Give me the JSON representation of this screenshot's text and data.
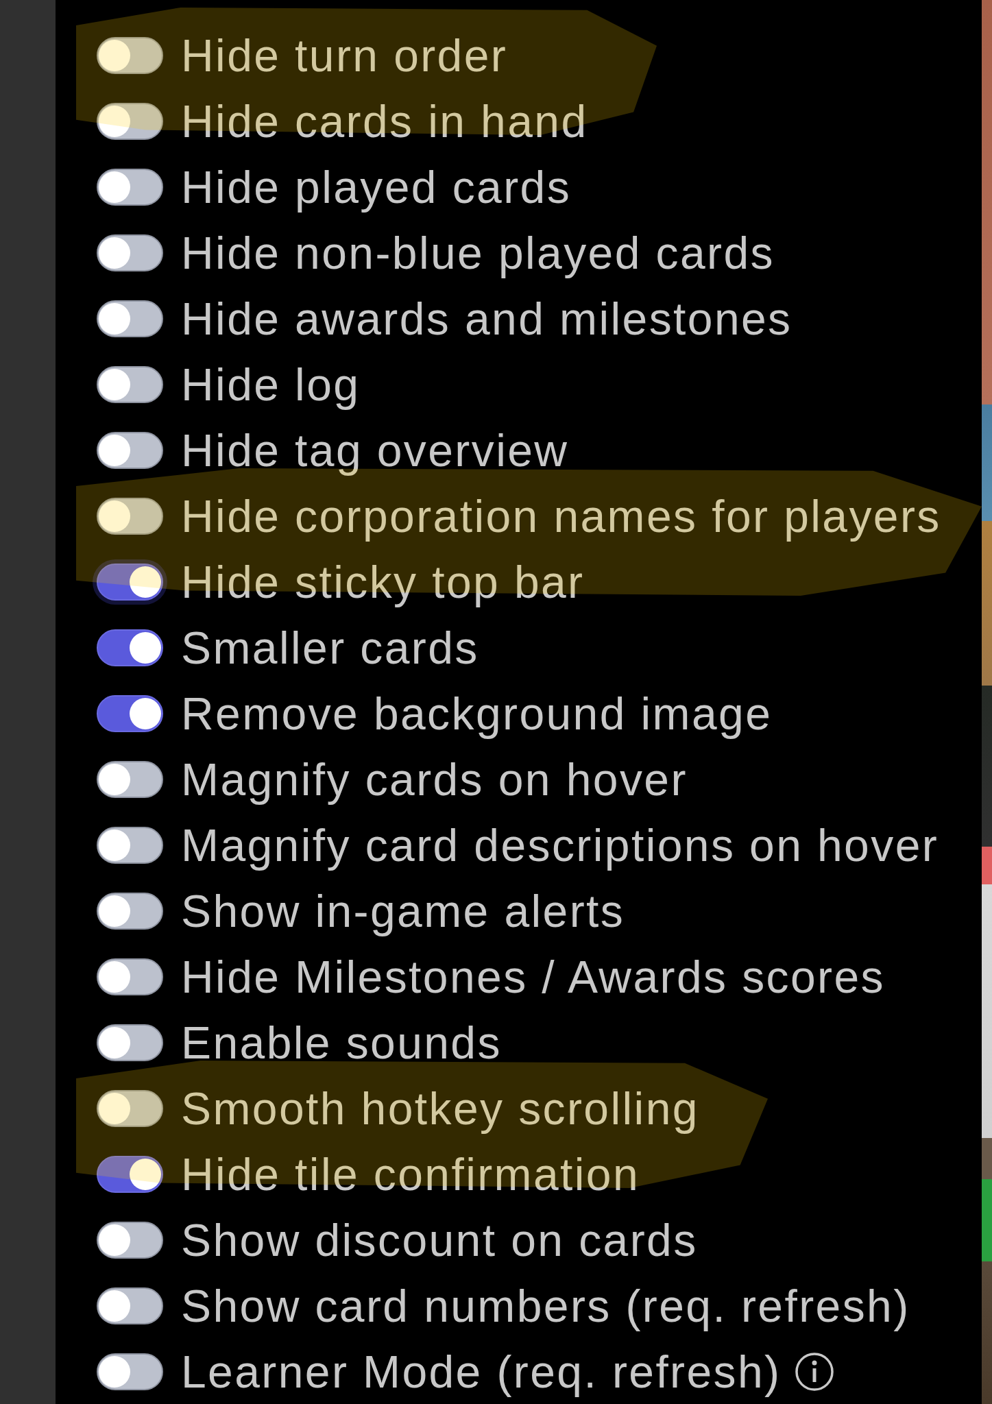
{
  "settings": [
    {
      "label": "Hide turn order",
      "on": false,
      "focused": false,
      "highlighted": true,
      "info": false
    },
    {
      "label": "Hide cards in hand",
      "on": false,
      "focused": false,
      "highlighted": true,
      "info": false
    },
    {
      "label": "Hide played cards",
      "on": false,
      "focused": false,
      "highlighted": false,
      "info": false
    },
    {
      "label": "Hide non-blue played cards",
      "on": false,
      "focused": false,
      "highlighted": false,
      "info": false
    },
    {
      "label": "Hide awards and milestones",
      "on": false,
      "focused": false,
      "highlighted": false,
      "info": false
    },
    {
      "label": "Hide log",
      "on": false,
      "focused": false,
      "highlighted": false,
      "info": false
    },
    {
      "label": "Hide tag overview",
      "on": false,
      "focused": false,
      "highlighted": false,
      "info": false
    },
    {
      "label": "Hide corporation names for players",
      "on": false,
      "focused": false,
      "highlighted": true,
      "info": false
    },
    {
      "label": "Hide sticky top bar",
      "on": true,
      "focused": true,
      "highlighted": true,
      "info": false
    },
    {
      "label": "Smaller cards",
      "on": true,
      "focused": false,
      "highlighted": false,
      "info": false
    },
    {
      "label": "Remove background image",
      "on": true,
      "focused": false,
      "highlighted": false,
      "info": false
    },
    {
      "label": "Magnify cards on hover",
      "on": false,
      "focused": false,
      "highlighted": false,
      "info": false
    },
    {
      "label": "Magnify card descriptions on hover",
      "on": false,
      "focused": false,
      "highlighted": false,
      "info": false
    },
    {
      "label": "Show in-game alerts",
      "on": false,
      "focused": false,
      "highlighted": false,
      "info": false
    },
    {
      "label": "Hide Milestones / Awards scores",
      "on": false,
      "focused": false,
      "highlighted": false,
      "info": false
    },
    {
      "label": "Enable sounds",
      "on": false,
      "focused": false,
      "highlighted": false,
      "info": false
    },
    {
      "label": "Smooth hotkey scrolling",
      "on": false,
      "focused": false,
      "highlighted": true,
      "info": false
    },
    {
      "label": "Hide tile confirmation",
      "on": true,
      "focused": false,
      "highlighted": true,
      "info": false
    },
    {
      "label": "Show discount on cards",
      "on": false,
      "focused": false,
      "highlighted": false,
      "info": false
    },
    {
      "label": "Show card numbers (req. refresh)",
      "on": false,
      "focused": false,
      "highlighted": false,
      "info": false
    },
    {
      "label": "Learner Mode (req. refresh)",
      "on": false,
      "focused": false,
      "highlighted": false,
      "info": true
    }
  ]
}
